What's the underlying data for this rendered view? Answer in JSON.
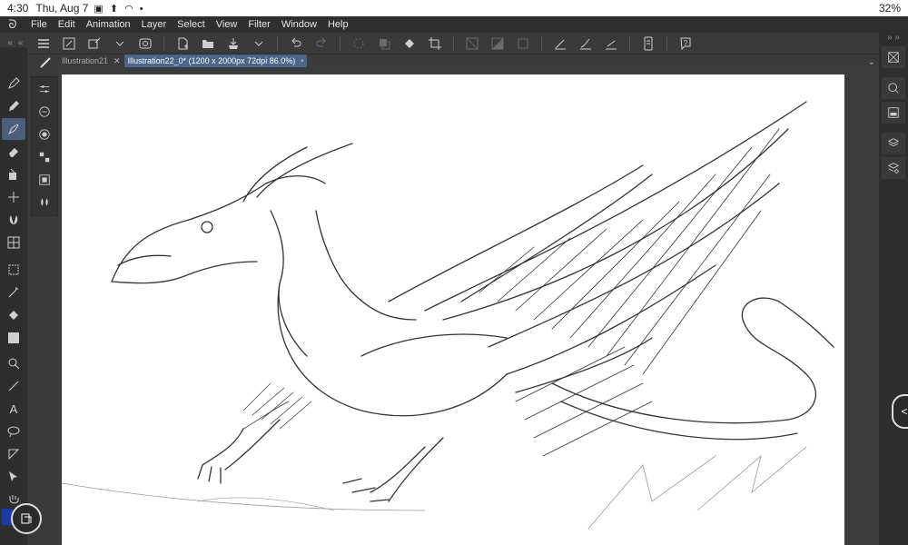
{
  "status": {
    "time": "4:30",
    "date": "Thu, Aug 7",
    "battery": "32%"
  },
  "menu": [
    "File",
    "Edit",
    "Animation",
    "Layer",
    "Select",
    "View",
    "Filter",
    "Window",
    "Help"
  ],
  "tabs": [
    {
      "label": "Illustration21",
      "active": false
    },
    {
      "label": "Illustration22_0* (1200 x 2000px 72dpi 86.0%)",
      "active": true
    }
  ],
  "colors": {
    "accent": "#4c6689",
    "main_color": "#1a3aa8",
    "canvas": "#ffffff"
  },
  "tools": [
    "pen-icon",
    "pencil-icon",
    "brush-icon",
    "eraser-icon",
    "fill-icon",
    "sparkle-icon",
    "blend-icon",
    "grid-icon",
    "select-rect-icon",
    "magic-wand-icon",
    "bucket-icon",
    "gradient-icon",
    "figure-icon",
    "line-icon",
    "text-icon",
    "lasso-icon",
    "shape-icon",
    "operation-icon",
    "hand-icon"
  ]
}
